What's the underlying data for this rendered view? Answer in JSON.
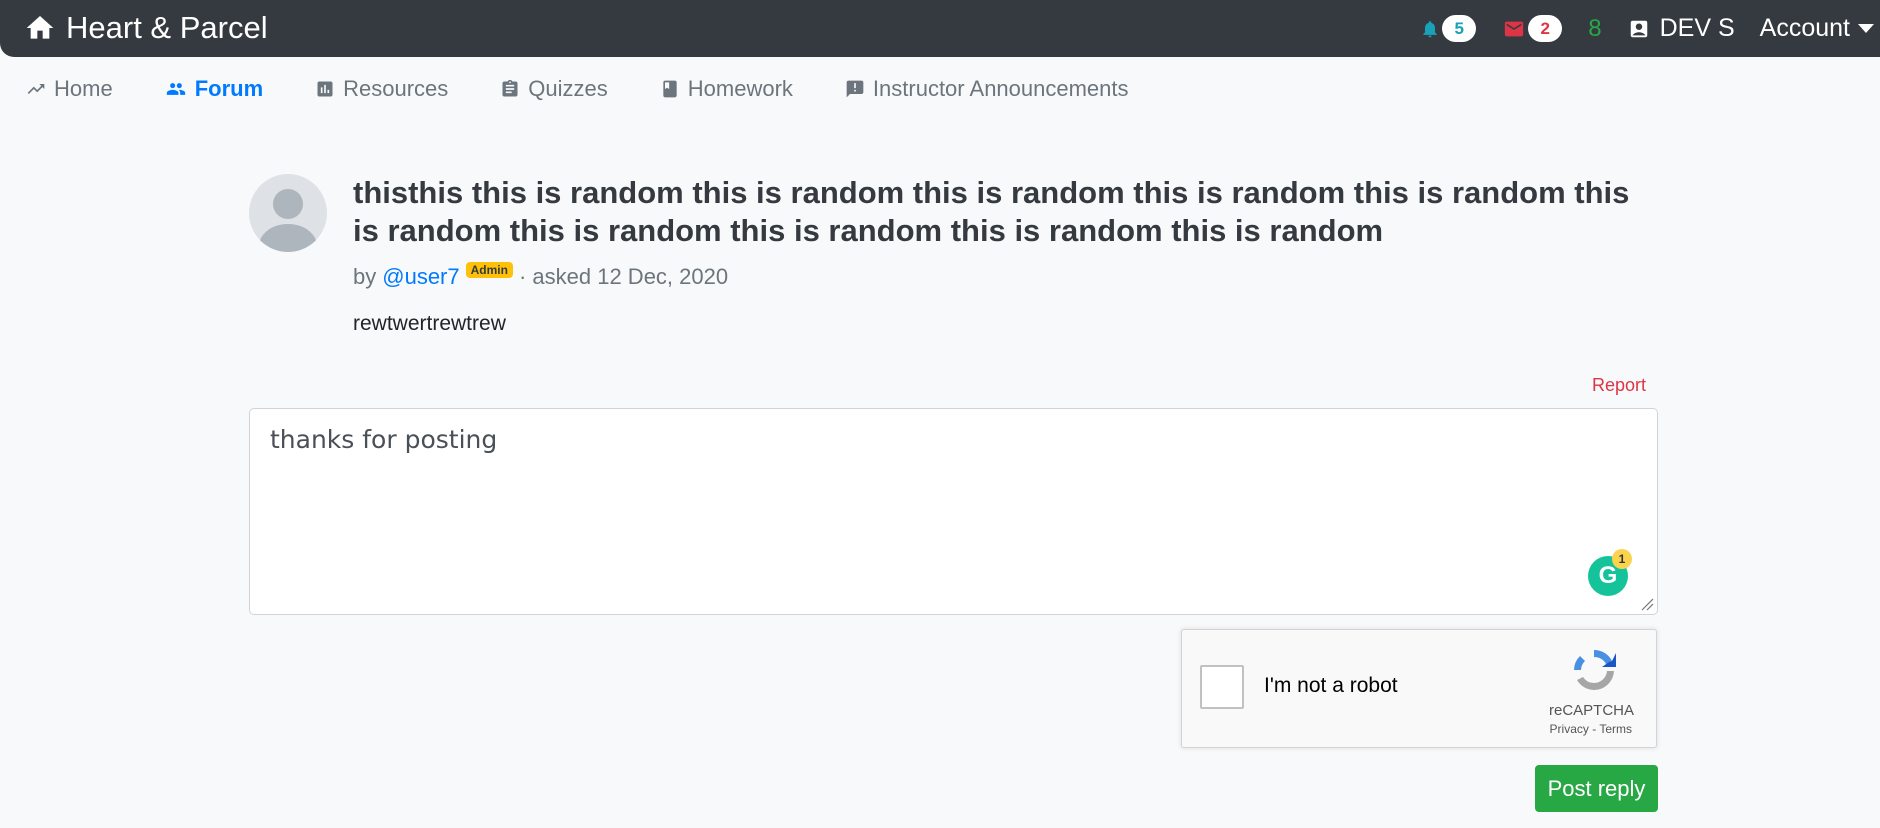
{
  "navbar": {
    "brand": "Heart & Parcel",
    "notifications_count": "5",
    "messages_count": "2",
    "green_count": "8",
    "user_name": "DEV S",
    "account_label": "Account"
  },
  "subnav": {
    "items": [
      {
        "label": "Home"
      },
      {
        "label": "Forum"
      },
      {
        "label": "Resources"
      },
      {
        "label": "Quizzes"
      },
      {
        "label": "Homework"
      },
      {
        "label": "Instructor Announcements"
      }
    ]
  },
  "question": {
    "title": "thisthis this is random this is random this is random this is random this is random this is random this is random this is random this is random this is random",
    "by": "by",
    "author": "@user7",
    "author_badge": "Admin",
    "asked": "· asked 12 Dec, 2020",
    "body": "rewtwertrewtrew",
    "report_label": "Report"
  },
  "reply": {
    "value": "thanks for posting",
    "grammarly_count": "1"
  },
  "captcha": {
    "label": "I'm not a robot",
    "brand": "reCAPTCHA",
    "terms": "Privacy - Terms"
  },
  "actions": {
    "post_label": "Post reply"
  },
  "colors": {
    "navbar": "#343a40",
    "active_link": "#007bff",
    "report": "#dc3545",
    "post_button": "#28a745",
    "admin_badge": "#ffc107"
  }
}
